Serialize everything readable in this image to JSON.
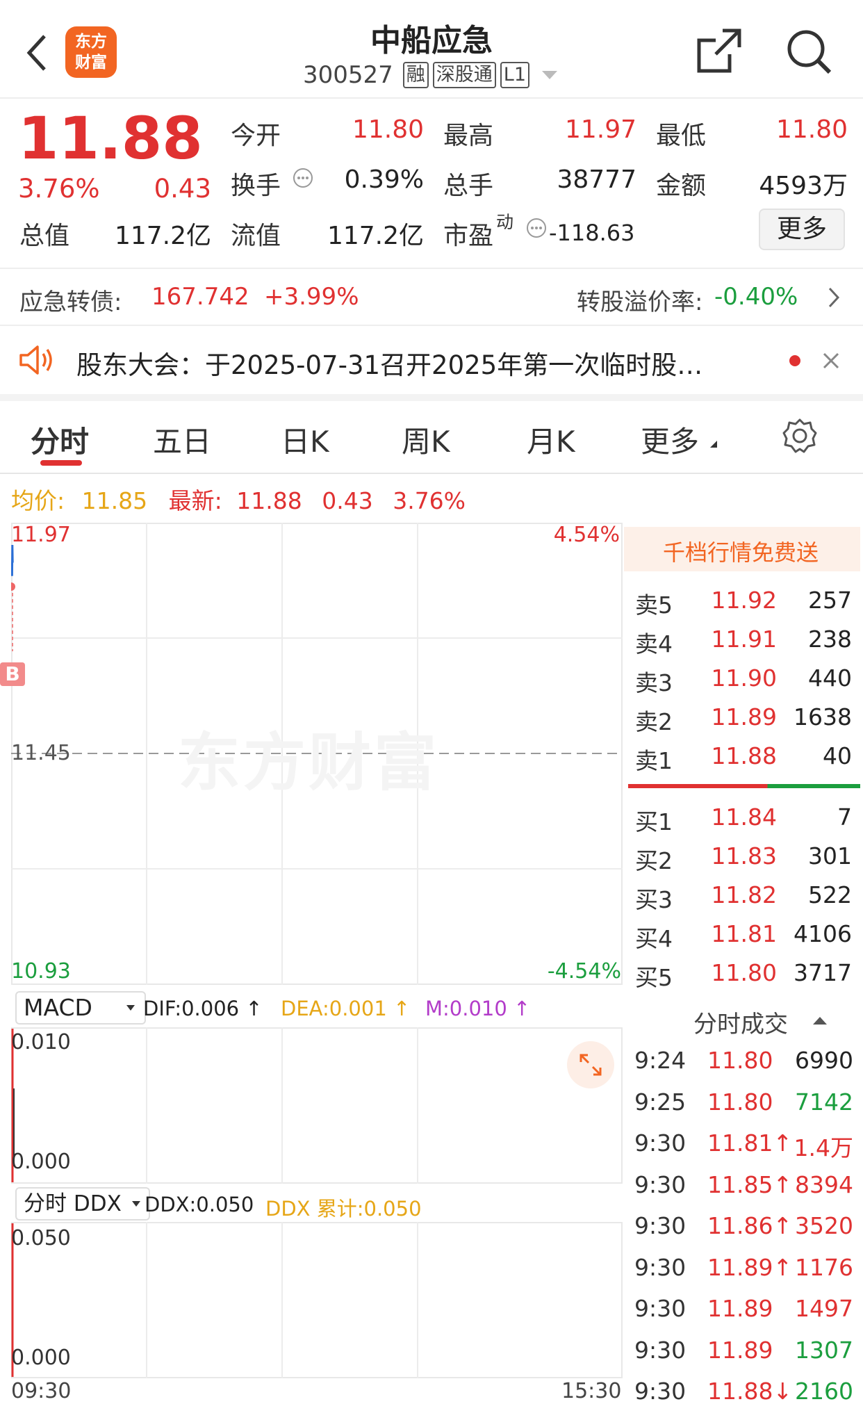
{
  "header": {
    "logo_text": "东方财富",
    "title": "中船应急",
    "code": "300527",
    "tags": [
      "融",
      "深股通",
      "L1"
    ]
  },
  "quote": {
    "price": "11.88",
    "change_pct": "3.76%",
    "change": "0.43",
    "labels": {
      "open": "今开",
      "high": "最高",
      "low": "最低",
      "turnover": "换手",
      "volume": "总手",
      "amount": "金额",
      "mktcap": "总值",
      "float_cap": "流值",
      "pe": "市盈",
      "pe_sup": "动"
    },
    "open": "11.80",
    "high": "11.97",
    "low": "11.80",
    "turnover": "0.39%",
    "volume": "38777",
    "amount": "4593万",
    "mktcap": "117.2亿",
    "float_cap": "117.2亿",
    "pe": "-118.63",
    "more_label": "更多"
  },
  "convertible": {
    "label": "应急转债:",
    "price": "167.742",
    "change": "+3.99%",
    "premium_label": "转股溢价率:",
    "premium_value": "-0.40%"
  },
  "notice": {
    "text": "股东大会：于2025-07-31召开2025年第一次临时股…"
  },
  "tabs": [
    "分时",
    "五日",
    "日K",
    "周K",
    "月K",
    "更多"
  ],
  "avg_line": {
    "avg_label": "均价:",
    "avg_value": "11.85",
    "latest_label": "最新:",
    "latest_value": "11.88",
    "change": "0.43",
    "change_pct": "3.76%"
  },
  "chart_data": [
    {
      "type": "line",
      "title": "",
      "y_left_ticks": [
        "11.97",
        "11.45",
        "10.93"
      ],
      "y_right_ticks": [
        "4.54%",
        "-4.54%"
      ],
      "ylim": [
        10.93,
        11.97
      ],
      "reference_line": 11.45,
      "x_ticks": [
        "09:30",
        "15:30"
      ],
      "series": [
        {
          "values": [
            11.88,
            11.85,
            11.92,
            11.88
          ]
        }
      ],
      "buy_marker": "B",
      "watermark": "东方财富"
    },
    {
      "type": "bar",
      "indicator": "MACD",
      "dif": "DIF:0.006 ↑",
      "dea": "DEA:0.001 ↑",
      "m": "M:0.010 ↑",
      "y_ticks": [
        "0.010",
        "0.000"
      ]
    },
    {
      "type": "bar",
      "indicator": "分时 DDX",
      "ddx": "DDX:0.050",
      "ddx_cum": "DDX 累计:0.050",
      "y_ticks": [
        "0.050",
        "0.000"
      ]
    }
  ],
  "order_book": {
    "promo": "千档行情免费送",
    "asks": [
      {
        "label": "卖5",
        "price": "11.92",
        "vol": "257"
      },
      {
        "label": "卖4",
        "price": "11.91",
        "vol": "238"
      },
      {
        "label": "卖3",
        "price": "11.90",
        "vol": "440"
      },
      {
        "label": "卖2",
        "price": "11.89",
        "vol": "1638"
      },
      {
        "label": "卖1",
        "price": "11.88",
        "vol": "40"
      }
    ],
    "bids": [
      {
        "label": "买1",
        "price": "11.84",
        "vol": "7"
      },
      {
        "label": "买2",
        "price": "11.83",
        "vol": "301"
      },
      {
        "label": "买3",
        "price": "11.82",
        "vol": "522"
      },
      {
        "label": "买4",
        "price": "11.81",
        "vol": "4106"
      },
      {
        "label": "买5",
        "price": "11.80",
        "vol": "3717"
      }
    ]
  },
  "ticks": {
    "title": "分时成交",
    "rows": [
      {
        "time": "9:24",
        "price": "11.80",
        "vol": "6990",
        "vol_color": "#222222"
      },
      {
        "time": "9:25",
        "price": "11.80",
        "vol": "7142",
        "vol_color": "#1b9e3e"
      },
      {
        "time": "9:30",
        "price": "11.81↑",
        "vol": "1.4万",
        "vol_color": "#e03131"
      },
      {
        "time": "9:30",
        "price": "11.85↑",
        "vol": "8394",
        "vol_color": "#e03131"
      },
      {
        "time": "9:30",
        "price": "11.86↑",
        "vol": "3520",
        "vol_color": "#e03131"
      },
      {
        "time": "9:30",
        "price": "11.89↑",
        "vol": "1176",
        "vol_color": "#e03131"
      },
      {
        "time": "9:30",
        "price": "11.89",
        "vol": "1497",
        "vol_color": "#e03131"
      },
      {
        "time": "9:30",
        "price": "11.89",
        "vol": "1307",
        "vol_color": "#1b9e3e"
      },
      {
        "time": "9:30",
        "price": "11.88↓",
        "vol": "2160",
        "vol_color": "#1b9e3e"
      }
    ]
  },
  "colors": {
    "up": "#e03131",
    "down": "#1b9e3e",
    "brand": "#f26522",
    "avg": "#e6a617"
  },
  "icons": [
    "back-icon",
    "share-icon",
    "search-icon",
    "speaker-icon",
    "settings-icon",
    "expand-icon"
  ]
}
